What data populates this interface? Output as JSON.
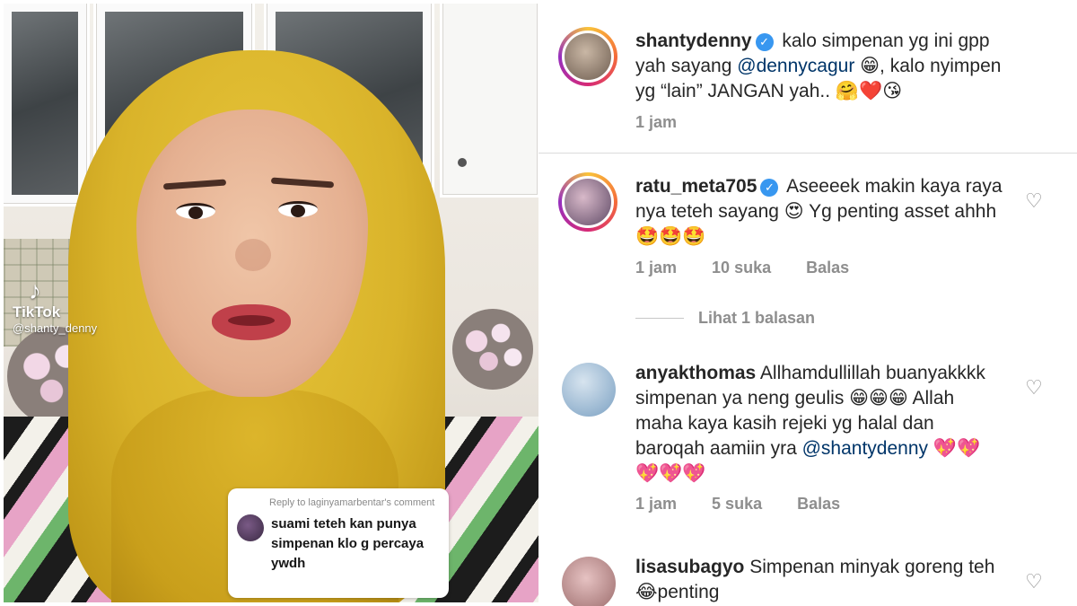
{
  "video": {
    "watermark_name": "TikTok",
    "watermark_handle": "@shanty_denny",
    "reply_card": {
      "header": "Reply to laginyamarbentar's comment",
      "text": "suami teteh kan punya simpenan klo g percaya ywdh"
    }
  },
  "comments": [
    {
      "username": "shantydenny",
      "verified": true,
      "text_parts": [
        "kalo simpenan yg ini gpp yah sayang ",
        "@dennycagur",
        " 😁, kalo nyimpen yg “lain” JANGAN yah.. 🤗❤️😘"
      ],
      "time": "1 jam",
      "likes": "",
      "reply_label": ""
    },
    {
      "username": "ratu_meta705",
      "verified": true,
      "text": "Aseeeek makin kaya raya nya teteh sayang 😍 Yg penting asset ahhh 🤩🤩🤩",
      "time": "1 jam",
      "likes": "10 suka",
      "reply_label": "Balas",
      "view_replies": "Lihat 1 balasan"
    },
    {
      "username": "anyakthomas",
      "verified": false,
      "text_parts": [
        "Allhamdullillah buanyakkkk simpenan ya neng geulis 😁😁😁 Allah maha kaya kasih rejeki yg halal dan baroqah aamiin yra ",
        "@shantydenny",
        " 💖💖💖💖💖"
      ],
      "time": "1 jam",
      "likes": "5 suka",
      "reply_label": "Balas"
    },
    {
      "username": "lisasubagyo",
      "verified": false,
      "text": "Simpenan minyak goreng teh 😂penting"
    }
  ],
  "icons": {
    "verified": "verified-badge-icon",
    "like": "heart-outline-icon",
    "tiktok": "tiktok-logo-icon"
  },
  "colors": {
    "verified_blue": "#3897f0",
    "mention": "#003569",
    "meta_gray": "#8e8e8e"
  }
}
